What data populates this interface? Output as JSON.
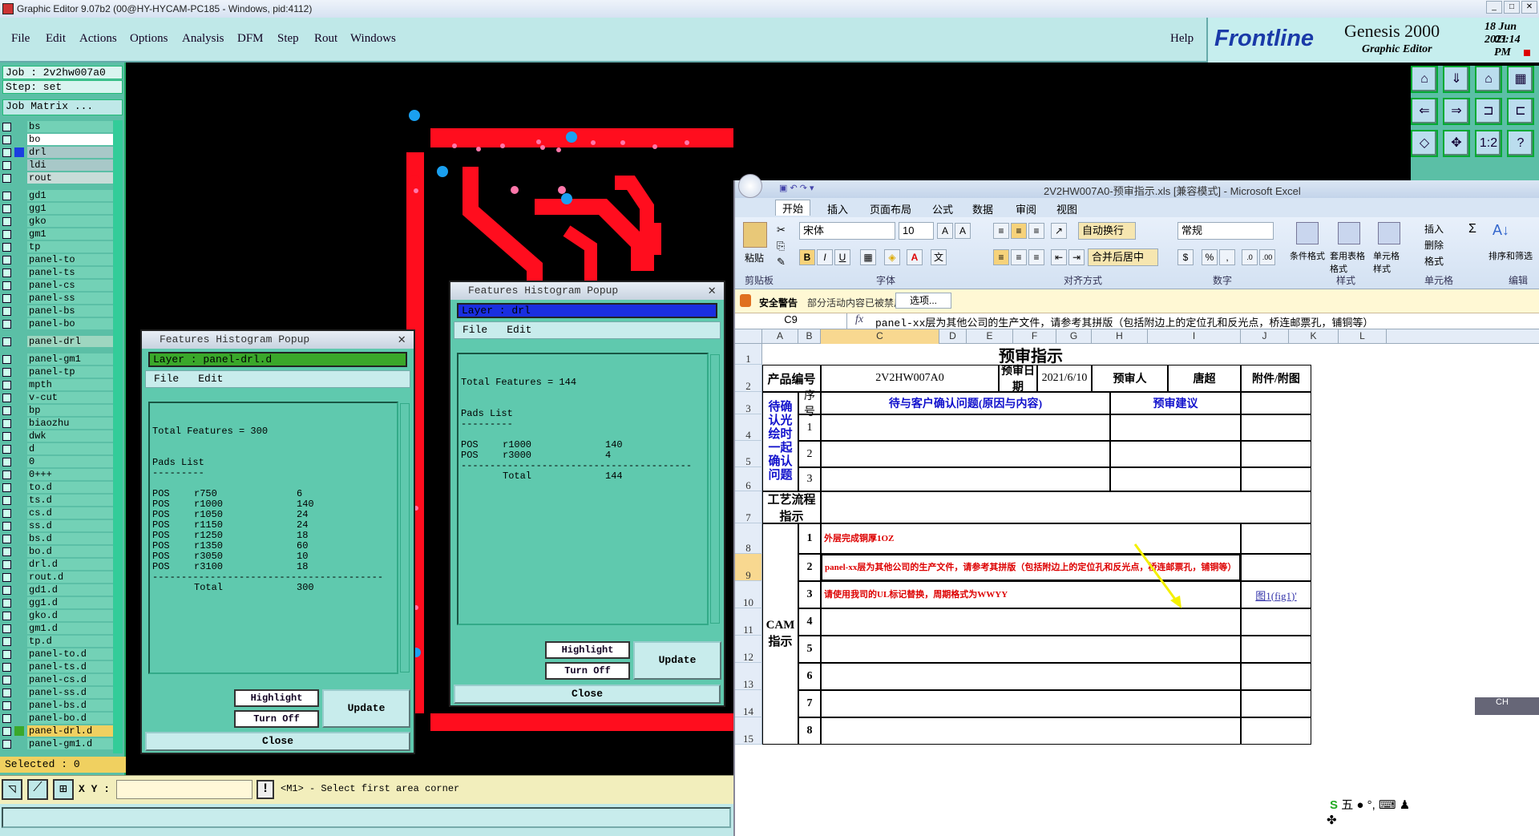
{
  "window": {
    "title": "Graphic Editor 9.07b2 (00@HY-HYCAM-PC185 - Windows, pid:4112)"
  },
  "menu": {
    "items": [
      "File",
      "Edit",
      "Actions",
      "Options",
      "Analysis",
      "DFM",
      "Step",
      "Rout",
      "Windows"
    ],
    "help": "Help"
  },
  "brand": {
    "logo": "Frontline",
    "product": "Genesis 2000",
    "subtitle": "Graphic Editor",
    "date": "18 Jun 2021",
    "time": "03:14 PM"
  },
  "left_panel": {
    "job": "Job : 2v2hw007a0",
    "step": "Step: set",
    "job_matrix": "Job Matrix ...",
    "layers": [
      "bs",
      "bo",
      "drl",
      "ldi",
      "rout",
      "gd1",
      "gg1",
      "gko",
      "gm1",
      "tp",
      "panel-to",
      "panel-ts",
      "panel-cs",
      "panel-ss",
      "panel-bs",
      "panel-bo",
      "panel-drl",
      "panel-gm1",
      "panel-tp",
      "mpth",
      "v-cut",
      "bp",
      "biaozhu",
      "dwk",
      "d",
      "0",
      "0+++",
      "to.d",
      "ts.d",
      "cs.d",
      "ss.d",
      "bs.d",
      "bo.d",
      "drl.d",
      "rout.d",
      "gd1.d",
      "gg1.d",
      "gko.d",
      "gm1.d",
      "tp.d",
      "panel-to.d",
      "panel-ts.d",
      "panel-cs.d",
      "panel-ss.d",
      "panel-bs.d",
      "panel-bo.d",
      "panel-drl.d",
      "panel-gm1.d"
    ],
    "selected": "Selected : 0"
  },
  "tools": {
    "icons": [
      "home-icon",
      "save-icon",
      "house-icon",
      "grid-icon",
      "zoom-in-icon",
      "zoom-out-icon",
      "pan-icon",
      "layout-icon",
      "fit-icon",
      "center-icon",
      "ratio-icon",
      "help-icon"
    ],
    "ratio_label": "1:2",
    "help_label": "?"
  },
  "status": {
    "xy_label": "X Y :",
    "xy_value": "",
    "message": "<M1> - Select first area corner"
  },
  "popup1": {
    "title": "Features Histogram Popup",
    "layer": "Layer :  panel-drl.d",
    "menu_file": "File",
    "menu_edit": "Edit",
    "total": "Total Features = 300",
    "list_title": "Pads List",
    "rows": [
      [
        "POS",
        "r750",
        "6"
      ],
      [
        "POS",
        "r1000",
        "140"
      ],
      [
        "POS",
        "r1050",
        "24"
      ],
      [
        "POS",
        "r1150",
        "24"
      ],
      [
        "POS",
        "r1250",
        "18"
      ],
      [
        "POS",
        "r1350",
        "60"
      ],
      [
        "POS",
        "r3050",
        "10"
      ],
      [
        "POS",
        "r3100",
        "18"
      ]
    ],
    "total_label": "Total",
    "total_value": "300",
    "highlight": "Highlight",
    "turn_off": "Turn Off",
    "update": "Update",
    "close": "Close",
    "layer_color": "#3aa82a"
  },
  "popup2": {
    "title": "Features Histogram Popup",
    "layer": "Layer :  drl",
    "menu_file": "File",
    "menu_edit": "Edit",
    "total": "Total Features = 144",
    "list_title": "Pads List",
    "rows": [
      [
        "POS",
        "r1000",
        "140"
      ],
      [
        "POS",
        "r3000",
        "4"
      ]
    ],
    "total_label": "Total",
    "total_value": "144",
    "highlight": "Highlight",
    "turn_off": "Turn Off",
    "update": "Update",
    "close": "Close",
    "layer_color": "#1a2ee0"
  },
  "excel": {
    "title": "2V2HW007A0-预审指示.xls  [兼容模式]  - Microsoft Excel",
    "tabs": [
      "开始",
      "插入",
      "页面布局",
      "公式",
      "数据",
      "审阅",
      "视图"
    ],
    "ribbon": {
      "paste": "粘贴",
      "clipboard": "剪贴板",
      "font_name": "宋体",
      "font_size": "10",
      "font_group": "字体",
      "wrap": "自动换行",
      "merge": "合并后居中",
      "align_group": "对齐方式",
      "number_format": "常规",
      "number_group": "数字",
      "cond_format": "条件格式",
      "table_format": "套用表格格式",
      "cell_style": "单元格样式",
      "style_group": "样式",
      "insert": "插入",
      "delete": "删除",
      "format": "格式",
      "cells_group": "单元格",
      "sort_filter": "排序和筛选",
      "edit_group": "编辑"
    },
    "security": {
      "label": "安全警告",
      "message": "部分活动内容已被禁用。",
      "options": "选项..."
    },
    "name_box": "C9",
    "formula": "panel-xx层为其他公司的生产文件，请参考其拼版（包括附边上的定位孔和反光点，桥连邮票孔，铺铜等）",
    "columns": [
      "A",
      "B",
      "C",
      "D",
      "E",
      "F",
      "G",
      "H",
      "I",
      "J",
      "K",
      "L"
    ],
    "sheet": {
      "heading": "预审指示",
      "product_label": "产品编号",
      "product_value": "2V2HW007A0",
      "date_label": "预审日期",
      "date_value": "2021/6/10",
      "reviewer_label": "预审人",
      "reviewer_value": "唐超",
      "attach_label": "附件/附图",
      "seq_label": "序号",
      "issue_header": "待与客户确认问题(原因与内容)",
      "advice_header": "预审建议",
      "pending_label": "待确认光绘时一起确认问题",
      "process_label": "工艺流程指示",
      "cam_label": "CAM指示",
      "cam_items": [
        "外层完成铜厚1OZ",
        "panel-xx层为其他公司的生产文件，请参考其拼版（包括附边上的定位孔和反光点，桥连邮票孔，铺铜等）",
        "请使用我司的UL标记替换，周期格式为WWYY",
        "",
        "",
        "",
        "",
        ""
      ],
      "attach_link": "图1(fig1)'"
    }
  },
  "ime": {
    "label": "五"
  },
  "ctrl": {
    "label": "CH"
  }
}
